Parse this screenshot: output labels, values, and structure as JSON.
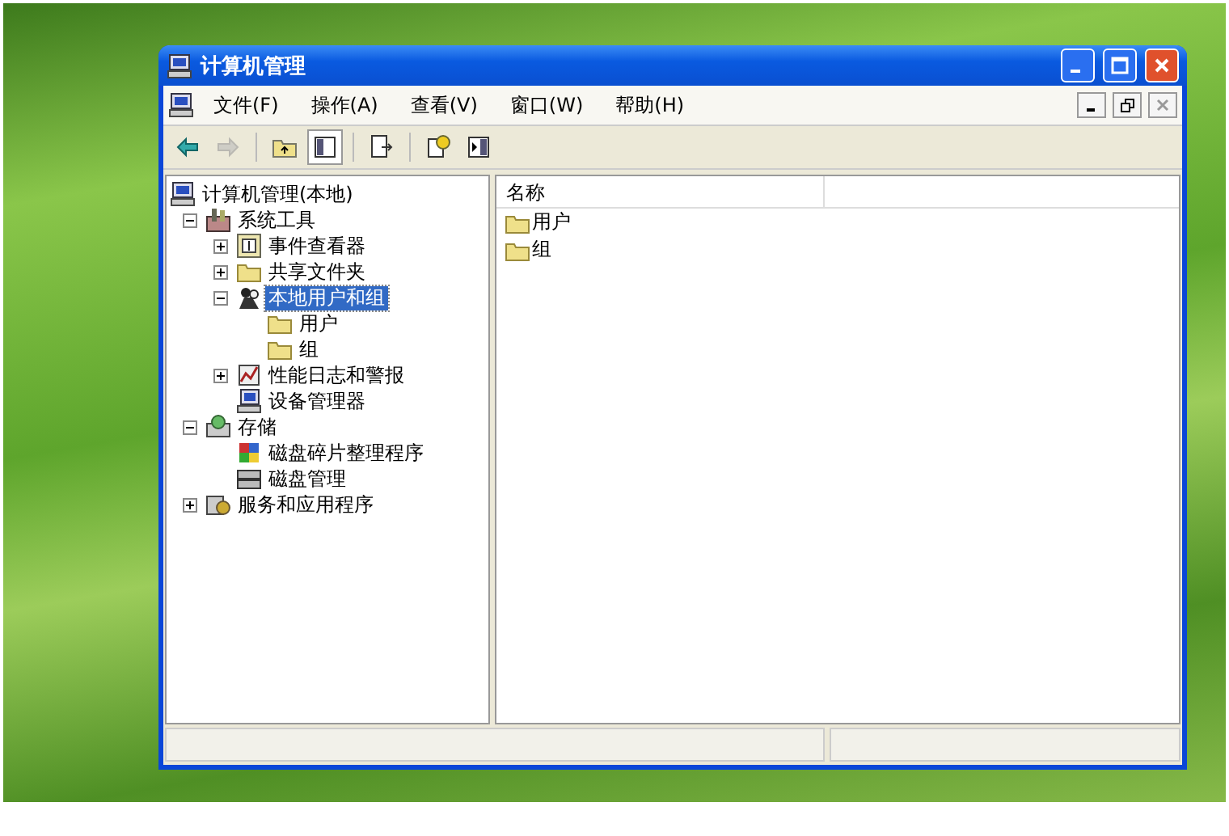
{
  "window": {
    "title": "计算机管理"
  },
  "menu": [
    {
      "label": "文件(F)"
    },
    {
      "label": "操作(A)"
    },
    {
      "label": "查看(V)"
    },
    {
      "label": "窗口(W)"
    },
    {
      "label": "帮助(H)"
    }
  ],
  "toolbar": [
    {
      "kind": "back",
      "disabled": false
    },
    {
      "kind": "forward",
      "disabled": true
    },
    {
      "kind": "sep"
    },
    {
      "kind": "up",
      "disabled": false
    },
    {
      "kind": "tree",
      "disabled": false,
      "selected": true
    },
    {
      "kind": "sep"
    },
    {
      "kind": "export",
      "disabled": false
    },
    {
      "kind": "sep"
    },
    {
      "kind": "help",
      "disabled": false
    },
    {
      "kind": "panel",
      "disabled": false
    }
  ],
  "tree": [
    {
      "label": "计算机管理(本地)",
      "kind": "computer",
      "selected": false,
      "children": [
        {
          "label": "系统工具",
          "kind": "tools",
          "expanded": true,
          "selected": false,
          "children": [
            {
              "label": "事件查看器",
              "kind": "event",
              "expanded": false,
              "selected": false
            },
            {
              "label": "共享文件夹",
              "kind": "folder",
              "expanded": false,
              "selected": false
            },
            {
              "label": "本地用户和组",
              "kind": "users",
              "expanded": true,
              "selected": true,
              "children": [
                {
                  "label": "用户",
                  "kind": "folder",
                  "selected": false
                },
                {
                  "label": "组",
                  "kind": "folder",
                  "selected": false
                }
              ]
            },
            {
              "label": "性能日志和警报",
              "kind": "perf",
              "expanded": false,
              "selected": false
            },
            {
              "label": "设备管理器",
              "kind": "device",
              "selected": false
            }
          ]
        },
        {
          "label": "存储",
          "kind": "storage",
          "expanded": true,
          "selected": false,
          "children": [
            {
              "label": "磁盘碎片整理程序",
              "kind": "defrag",
              "selected": false
            },
            {
              "label": "磁盘管理",
              "kind": "disk",
              "selected": false
            }
          ]
        },
        {
          "label": "服务和应用程序",
          "kind": "services",
          "expanded": false,
          "selected": false
        }
      ]
    }
  ],
  "list": {
    "columns": [
      "名称"
    ],
    "items": [
      {
        "label": "用户",
        "kind": "folder"
      },
      {
        "label": "组",
        "kind": "folder"
      }
    ]
  }
}
